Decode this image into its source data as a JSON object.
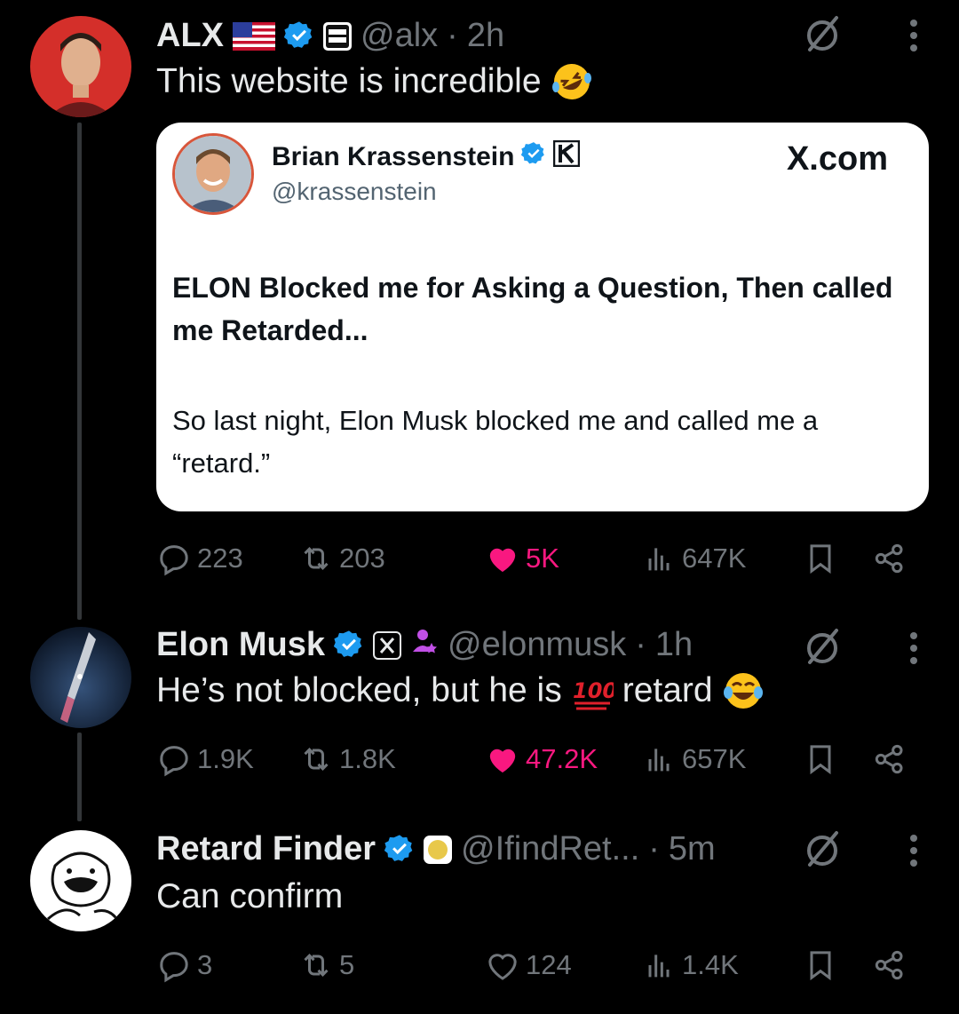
{
  "tweets": [
    {
      "name": "ALX",
      "handle": "@alx",
      "time": "2h",
      "text": "This website is incredible",
      "quote": {
        "name": "Brian Krassenstein",
        "handle": "@krassenstein",
        "site": "X.com",
        "headline": "ELON Blocked me for Asking a Question, Then called me Retarded...",
        "body": "So last night, Elon Musk blocked me and called me a “retard.”"
      },
      "stats": {
        "replies": "223",
        "reposts": "203",
        "likes": "5K",
        "views": "647K"
      }
    },
    {
      "name": "Elon Musk",
      "handle": "@elonmusk",
      "time": "1h",
      "text_before": "He’s not blocked, but he is",
      "text_after": "retard",
      "stats": {
        "replies": "1.9K",
        "reposts": "1.8K",
        "likes": "47.2K",
        "views": "657K"
      }
    },
    {
      "name": "Retard Finder",
      "handle": "@IfindRet...",
      "time": "5m",
      "text": "Can confirm",
      "stats": {
        "replies": "3",
        "reposts": "5",
        "likes": "124",
        "views": "1.4K"
      }
    }
  ],
  "colors": {
    "background": "#000000",
    "verified": "#1d9bf0",
    "like": "#f91880",
    "muted": "#71767b"
  }
}
